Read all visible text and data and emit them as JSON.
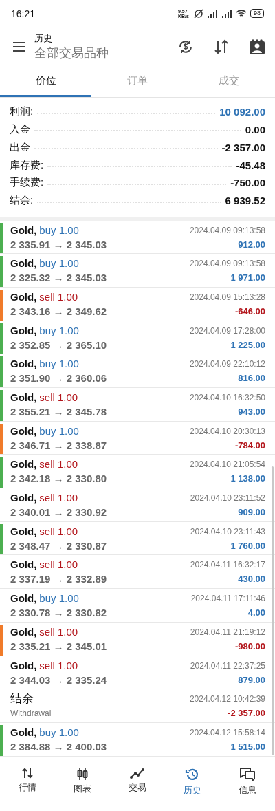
{
  "status_bar": {
    "time": "16:21",
    "net_speed": "9.57 KB/s",
    "battery": "98"
  },
  "header": {
    "title": "历史",
    "subtitle": "全部交易品种"
  },
  "tabs": [
    {
      "label": "价位",
      "selected": true
    },
    {
      "label": "订单",
      "selected": false
    },
    {
      "label": "成交",
      "selected": false
    }
  ],
  "summary": [
    {
      "label": "利润:",
      "value": "10 092.00",
      "highlight": true
    },
    {
      "label": "入金",
      "value": "0.00",
      "highlight": false
    },
    {
      "label": "出金",
      "value": "-2 357.00",
      "highlight": false
    },
    {
      "label": "库存费:",
      "value": "-45.48",
      "highlight": false
    },
    {
      "label": "手续费:",
      "value": "-750.00",
      "highlight": false
    },
    {
      "label": "结余:",
      "value": "6 939.52",
      "highlight": false
    }
  ],
  "deals": [
    {
      "kind": "buy",
      "symbol": "Gold,",
      "action": "buy 1.00",
      "prices": "2 335.91 → 2 345.03",
      "time": "2024.04.09 09:13:58",
      "profit": "912.00",
      "loss": false,
      "color": "#4caf50"
    },
    {
      "kind": "buy",
      "symbol": "Gold,",
      "action": "buy 1.00",
      "prices": "2 325.32 → 2 345.03",
      "time": "2024.04.09 09:13:58",
      "profit": "1 971.00",
      "loss": false,
      "color": "#4caf50"
    },
    {
      "kind": "sell",
      "symbol": "Gold,",
      "action": "sell 1.00",
      "prices": "2 343.16 → 2 349.62",
      "time": "2024.04.09 15:13:28",
      "profit": "-646.00",
      "loss": true,
      "color": "#f07b2a"
    },
    {
      "kind": "buy",
      "symbol": "Gold,",
      "action": "buy 1.00",
      "prices": "2 352.85 → 2 365.10",
      "time": "2024.04.09 17:28:00",
      "profit": "1 225.00",
      "loss": false,
      "color": "#4caf50"
    },
    {
      "kind": "buy",
      "symbol": "Gold,",
      "action": "buy 1.00",
      "prices": "2 351.90 → 2 360.06",
      "time": "2024.04.09 22:10:12",
      "profit": "816.00",
      "loss": false,
      "color": "#4caf50"
    },
    {
      "kind": "sell",
      "symbol": "Gold,",
      "action": "sell 1.00",
      "prices": "2 355.21 → 2 345.78",
      "time": "2024.04.10 16:32:50",
      "profit": "943.00",
      "loss": false,
      "color": "#4caf50"
    },
    {
      "kind": "buy",
      "symbol": "Gold,",
      "action": "buy 1.00",
      "prices": "2 346.71 → 2 338.87",
      "time": "2024.04.10 20:30:13",
      "profit": "-784.00",
      "loss": true,
      "color": "#f07b2a"
    },
    {
      "kind": "sell",
      "symbol": "Gold,",
      "action": "sell 1.00",
      "prices": "2 342.18 → 2 330.80",
      "time": "2024.04.10 21:05:54",
      "profit": "1 138.00",
      "loss": false,
      "color": "#4caf50"
    },
    {
      "kind": "sell",
      "symbol": "Gold,",
      "action": "sell 1.00",
      "prices": "2 340.01 → 2 330.92",
      "time": "2024.04.10 23:11:52",
      "profit": "909.00",
      "loss": false
    },
    {
      "kind": "sell",
      "symbol": "Gold,",
      "action": "sell 1.00",
      "prices": "2 348.47 → 2 330.87",
      "time": "2024.04.10 23:11:43",
      "profit": "1 760.00",
      "loss": false,
      "color": "#4caf50"
    },
    {
      "kind": "sell",
      "symbol": "Gold,",
      "action": "sell 1.00",
      "prices": "2 337.19 → 2 332.89",
      "time": "2024.04.11 16:32:17",
      "profit": "430.00",
      "loss": false
    },
    {
      "kind": "buy",
      "symbol": "Gold,",
      "action": "buy 1.00",
      "prices": "2 330.78 → 2 330.82",
      "time": "2024.04.11 17:11:46",
      "profit": "4.00",
      "loss": false
    },
    {
      "kind": "sell",
      "symbol": "Gold,",
      "action": "sell 1.00",
      "prices": "2 335.21 → 2 345.01",
      "time": "2024.04.11 21:19:12",
      "profit": "-980.00",
      "loss": true,
      "color": "#f07b2a"
    },
    {
      "kind": "sell",
      "symbol": "Gold,",
      "action": "sell 1.00",
      "prices": "2 344.03 → 2 335.24",
      "time": "2024.04.11 22:37:25",
      "profit": "879.00",
      "loss": false
    },
    {
      "kind": "balance",
      "title": "结余",
      "note": "Withdrawal",
      "time": "2024.04.12 10:42:39",
      "profit": "-2 357.00",
      "loss": true
    },
    {
      "kind": "buy",
      "symbol": "Gold,",
      "action": "buy 1.00",
      "prices": "2 384.88 → 2 400.03",
      "time": "2024.04.12 15:58:14",
      "profit": "1 515.00",
      "loss": false,
      "color": "#4caf50"
    }
  ],
  "nav": [
    {
      "label": "行情",
      "selected": false
    },
    {
      "label": "图表",
      "selected": false
    },
    {
      "label": "交易",
      "selected": false
    },
    {
      "label": "历史",
      "selected": true
    },
    {
      "label": "信息",
      "selected": false
    }
  ]
}
